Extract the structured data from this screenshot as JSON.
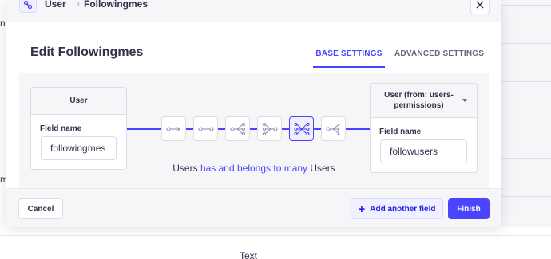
{
  "background": {
    "left_fragments": [
      "ngs",
      "m"
    ],
    "bottom_text": "Text"
  },
  "modal": {
    "breadcrumb": {
      "icon": "relation-icon",
      "items": [
        "User",
        "Followingmes"
      ]
    },
    "title": "Edit Followingmes",
    "tabs": [
      {
        "label": "BASE SETTINGS",
        "active": true
      },
      {
        "label": "ADVANCED SETTINGS",
        "active": false
      }
    ],
    "left_card": {
      "header": "User",
      "field_label": "Field name",
      "field_value": "followingmes"
    },
    "right_card": {
      "header": "User (from: users-permissions)",
      "field_label": "Field name",
      "field_value": "followusers"
    },
    "relations": [
      {
        "icon": "one-way-icon",
        "active": false
      },
      {
        "icon": "one-to-one-icon",
        "active": false
      },
      {
        "icon": "one-to-many-icon",
        "active": false
      },
      {
        "icon": "many-to-one-icon",
        "active": false
      },
      {
        "icon": "many-to-many-icon",
        "active": true
      },
      {
        "icon": "many-way-icon",
        "active": false
      }
    ],
    "relation_text": {
      "left": "Users",
      "highlight": "has and belongs to many",
      "right": "Users"
    },
    "footer": {
      "cancel": "Cancel",
      "add_field": "Add another field",
      "finish": "Finish"
    }
  },
  "colors": {
    "accent": "#4945ff",
    "panel": "#f6f6f9",
    "border": "#dcdce4"
  }
}
